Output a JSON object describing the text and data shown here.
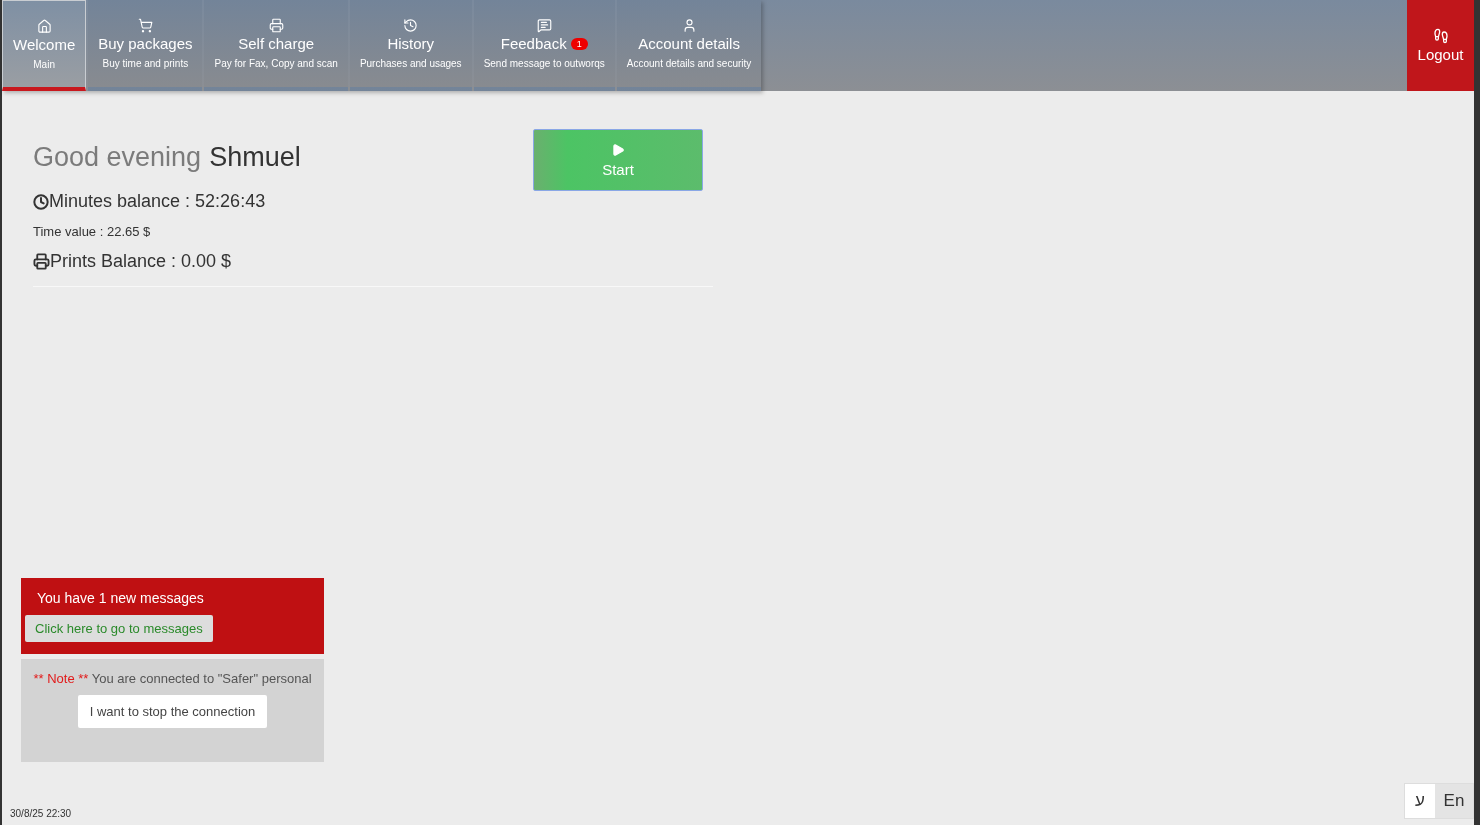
{
  "tabs": [
    {
      "kind": "home",
      "label": "Welcome",
      "subtitle": "Main",
      "selected": true
    },
    {
      "kind": "cart",
      "label": "Buy packages",
      "subtitle": "Buy time and prints",
      "selected": false
    },
    {
      "kind": "printer",
      "label": "Self charge",
      "subtitle": "Pay for Fax, Copy and scan",
      "selected": false
    },
    {
      "kind": "history",
      "label": "History",
      "subtitle": "Purchases and usages",
      "selected": false
    },
    {
      "kind": "message",
      "label": "Feedback",
      "badge": "1",
      "subtitle": "Send message to outworqs",
      "selected": false
    },
    {
      "kind": "user",
      "label": "Account details",
      "subtitle": "Account details and security",
      "selected": false
    }
  ],
  "logout": {
    "label": "Logout"
  },
  "greeting": {
    "salutation": "Good evening",
    "name": "Shmuel"
  },
  "start_button": {
    "label": "Start"
  },
  "balances": [
    {
      "kind": "clock",
      "text": "Minutes balance : 52:26:43"
    },
    {
      "kind": "small",
      "text": "Time value : 22.65 $"
    },
    {
      "kind": "printer",
      "text": "Prints Balance : 0.00 $"
    }
  ],
  "messages_panel": {
    "text": "You have 1 new messages",
    "button": "Click here to go to messages"
  },
  "note_panel": {
    "note_label": "** Note **",
    "text": "You are connected to \"Safer\" personal",
    "button": "I want to stop the connection"
  },
  "timestamp": "30/8/25 22:30",
  "languages": [
    {
      "label": "ע",
      "selected": false
    },
    {
      "label": "En",
      "selected": true
    }
  ]
}
